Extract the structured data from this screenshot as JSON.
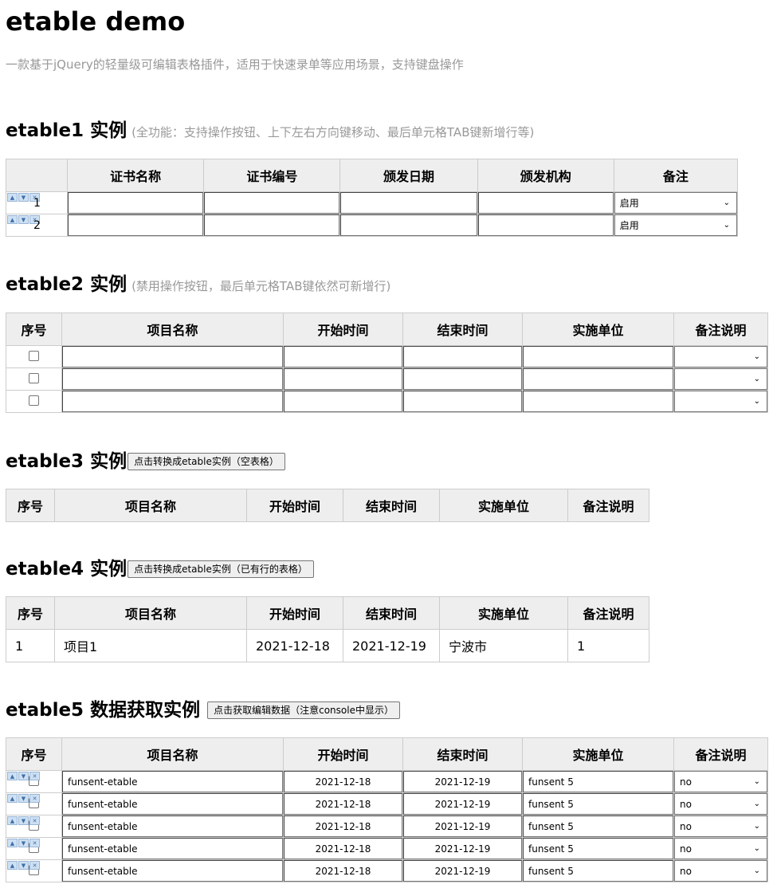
{
  "page": {
    "title": "etable demo",
    "description": "一款基于jQuery的轻量级可编辑表格插件，适用于快速录单等应用场景，支持键盘操作"
  },
  "etable1": {
    "title": "etable1 实例",
    "subtitle": "(全功能：支持操作按钮、上下左右方向键移动、最后单元格TAB键新增行等)",
    "headers": [
      "",
      "证书名称",
      "证书编号",
      "颁发日期",
      "颁发机构",
      "备注"
    ],
    "rows": [
      {
        "num": "1",
        "remark": "启用"
      },
      {
        "num": "2",
        "remark": "启用"
      }
    ]
  },
  "etable2": {
    "title": "etable2 实例",
    "subtitle": "(禁用操作按钮，最后单元格TAB键依然可新增行)",
    "headers": [
      "序号",
      "项目名称",
      "开始时间",
      "结束时间",
      "实施单位",
      "备注说明"
    ]
  },
  "etable3": {
    "title": "etable3 实例",
    "button": "点击转换成etable实例（空表格）",
    "headers": [
      "序号",
      "项目名称",
      "开始时间",
      "结束时间",
      "实施单位",
      "备注说明"
    ]
  },
  "etable4": {
    "title": "etable4 实例",
    "button": "点击转换成etable实例（已有行的表格）",
    "headers": [
      "序号",
      "项目名称",
      "开始时间",
      "结束时间",
      "实施单位",
      "备注说明"
    ],
    "row": [
      "1",
      "项目1",
      "2021-12-18",
      "2021-12-19",
      "宁波市",
      "1"
    ]
  },
  "etable5": {
    "title": "etable5 数据获取实例",
    "button": "点击获取编辑数据（注意console中显示）",
    "headers": [
      "序号",
      "项目名称",
      "开始时间",
      "结束时间",
      "实施单位",
      "备注说明"
    ],
    "rows": [
      {
        "name": "funsent-etable",
        "start": "2021-12-18",
        "end": "2021-12-19",
        "unit": "funsent 5",
        "remark": "no"
      },
      {
        "name": "funsent-etable",
        "start": "2021-12-18",
        "end": "2021-12-19",
        "unit": "funsent 5",
        "remark": "no"
      },
      {
        "name": "funsent-etable",
        "start": "2021-12-18",
        "end": "2021-12-19",
        "unit": "funsent 5",
        "remark": "no"
      },
      {
        "name": "funsent-etable",
        "start": "2021-12-18",
        "end": "2021-12-19",
        "unit": "funsent 5",
        "remark": "no"
      },
      {
        "name": "funsent-etable",
        "start": "2021-12-18",
        "end": "2021-12-19",
        "unit": "funsent 5",
        "remark": "no"
      }
    ]
  },
  "icons": {
    "row_up": "arrow-up-icon",
    "row_down": "arrow-down-icon",
    "row_delete": "delete-row-icon",
    "select": "chevron-down-icon"
  }
}
